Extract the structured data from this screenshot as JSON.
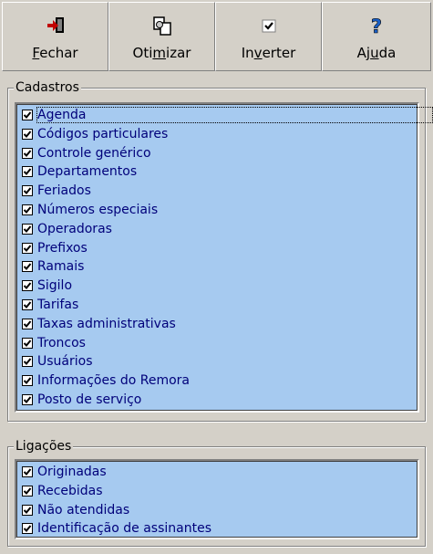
{
  "toolbar": {
    "buttons": [
      {
        "pre": "",
        "ul": "F",
        "post": "echar",
        "icon": "exit-door-icon"
      },
      {
        "pre": "Oti",
        "ul": "m",
        "post": "izar",
        "icon": "optimize-documents-icon"
      },
      {
        "pre": "In",
        "ul": "v",
        "post": "erter",
        "icon": "checkmark-icon"
      },
      {
        "pre": "Aj",
        "ul": "u",
        "post": "da",
        "icon": "help-question-icon"
      }
    ]
  },
  "cadastros": {
    "title": "Cadastros",
    "items": [
      {
        "label": "Agenda",
        "checked": true
      },
      {
        "label": "Códigos particulares",
        "checked": true
      },
      {
        "label": "Controle genérico",
        "checked": true
      },
      {
        "label": "Departamentos",
        "checked": true
      },
      {
        "label": "Feriados",
        "checked": true
      },
      {
        "label": "Números especiais",
        "checked": true
      },
      {
        "label": "Operadoras",
        "checked": true
      },
      {
        "label": "Prefixos",
        "checked": true
      },
      {
        "label": "Ramais",
        "checked": true
      },
      {
        "label": "Sigilo",
        "checked": true
      },
      {
        "label": "Tarifas",
        "checked": true
      },
      {
        "label": "Taxas administrativas",
        "checked": true
      },
      {
        "label": "Troncos",
        "checked": true
      },
      {
        "label": "Usuários",
        "checked": true
      },
      {
        "label": "Informações do Remora",
        "checked": true
      },
      {
        "label": "Posto de serviço",
        "checked": true
      }
    ]
  },
  "ligacoes": {
    "title": "Ligações",
    "items": [
      {
        "label": "Originadas",
        "checked": true
      },
      {
        "label": "Recebidas",
        "checked": true
      },
      {
        "label": "Não atendidas",
        "checked": true
      },
      {
        "label": "Identificação de assinantes",
        "checked": true
      }
    ]
  }
}
